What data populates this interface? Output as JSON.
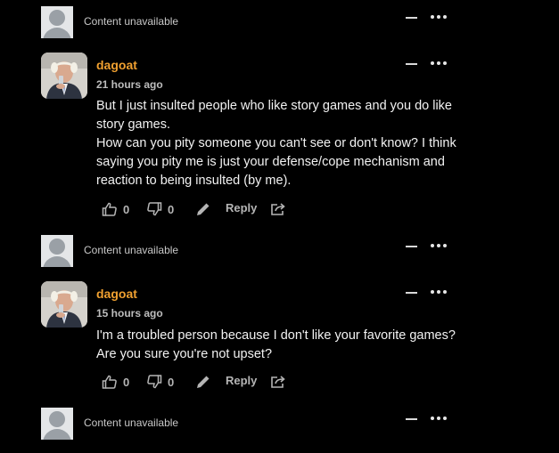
{
  "comments": [
    {
      "type": "unavailable",
      "text": "Content unavailable"
    },
    {
      "type": "comment",
      "username": "dagoat",
      "time": "21 hours ago",
      "lines": [
        "But I just insulted people who like story games and you do like",
        "story games.",
        "How can you pity someone you can't see or don't know? I think",
        "saying you pity me is just your defense/cope mechanism and",
        "reaction to being insulted (by me)."
      ],
      "likes": "0",
      "dislikes": "0",
      "reply_label": "Reply"
    },
    {
      "type": "unavailable",
      "text": "Content unavailable"
    },
    {
      "type": "comment",
      "username": "dagoat",
      "time": "15 hours ago",
      "lines": [
        "I'm a troubled person because I don't like your favorite games?",
        "Are you sure you're not upset?"
      ],
      "likes": "0",
      "dislikes": "0",
      "reply_label": "Reply"
    },
    {
      "type": "unavailable",
      "text": "Content unavailable"
    }
  ],
  "icons": {
    "collapse": "minus-icon",
    "more": "more-dots-icon",
    "like": "thumbs-up-icon",
    "dislike": "thumbs-down-icon",
    "edit": "pencil-icon",
    "share": "share-icon"
  }
}
